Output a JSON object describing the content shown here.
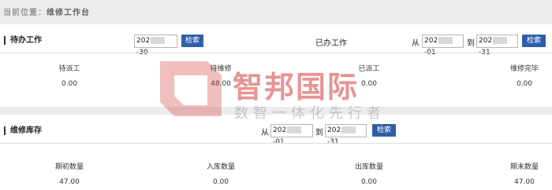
{
  "breadcrumb": {
    "prefix": "当前位置：",
    "current": "维修工作台"
  },
  "todo": {
    "title": "待办工作",
    "date_left": "202",
    "date_right": "-30",
    "search_label": "检索",
    "columns": [
      {
        "label": "待派工",
        "value": "0.00"
      },
      {
        "label": "待维修",
        "value": "48.00"
      },
      {
        "label": "已派工",
        "value": "0.00"
      },
      {
        "label": "维修完毕",
        "value": "0.00"
      }
    ]
  },
  "done": {
    "title": "已办工作",
    "from_label": "从",
    "to_label": "到",
    "from_left": "202",
    "from_right": "-01",
    "to_left": "202",
    "to_right": "-31",
    "search_label": "检索"
  },
  "stock": {
    "title": "维修库存",
    "from_label": "从",
    "to_label": "到",
    "from_left": "202",
    "from_right": "-01",
    "to_left": "202",
    "to_right": "-31",
    "search_label": "检索",
    "columns": [
      {
        "label": "期初数量",
        "value": "47.00"
      },
      {
        "label": "入库数量",
        "value": "0.00"
      },
      {
        "label": "出库数量",
        "value": "0.00"
      },
      {
        "label": "期末数量",
        "value": "47.00"
      }
    ]
  },
  "watermark": {
    "brand": "智邦国际",
    "slogan": "数智一体化先行者"
  }
}
